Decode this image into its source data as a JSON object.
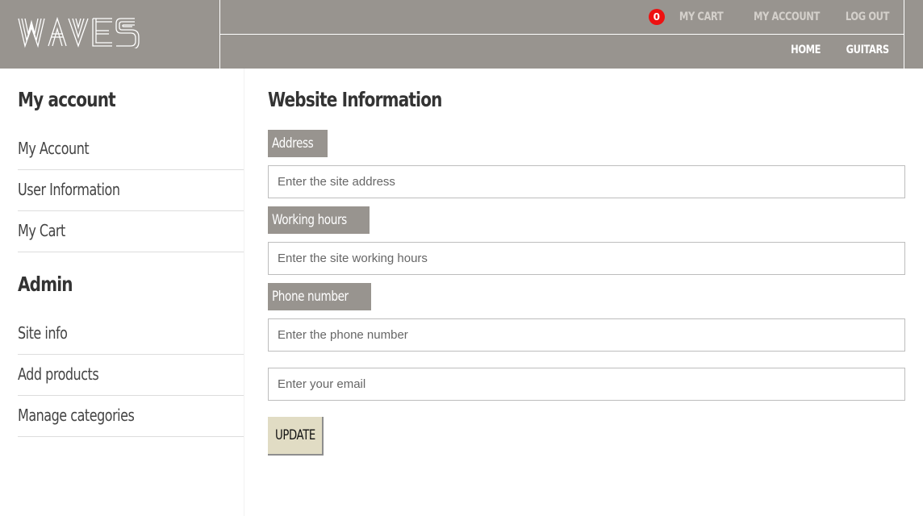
{
  "header": {
    "logo_text": "WAVES",
    "nav_top": {
      "cart_count": "0",
      "cart_label": "MY CART",
      "account_label": "MY ACCOUNT",
      "logout_label": "LOG OUT"
    },
    "nav_bottom": {
      "home_label": "HOME",
      "guitars_label": "GUITARS"
    }
  },
  "sidebar": {
    "account_heading": "My account",
    "account_items": [
      "My Account",
      "User Information",
      "My Cart"
    ],
    "admin_heading": "Admin",
    "admin_items": [
      "Site info",
      "Add products",
      "Manage categories"
    ]
  },
  "main": {
    "title": "Website Information",
    "fields": [
      {
        "label": "Address",
        "placeholder": "Enter the site address",
        "value": ""
      },
      {
        "label": "Working hours",
        "placeholder": "Enter the site working hours",
        "value": ""
      },
      {
        "label": "Phone number",
        "placeholder": "Enter the phone number",
        "value": ""
      },
      {
        "label": "",
        "placeholder": "Enter your email",
        "value": ""
      }
    ],
    "update_label": "UPDATE"
  },
  "colors": {
    "header_bg": "#98948f",
    "label_bg": "#98948f",
    "button_bg": "#e1dcc4",
    "badge": "#ee1111"
  }
}
